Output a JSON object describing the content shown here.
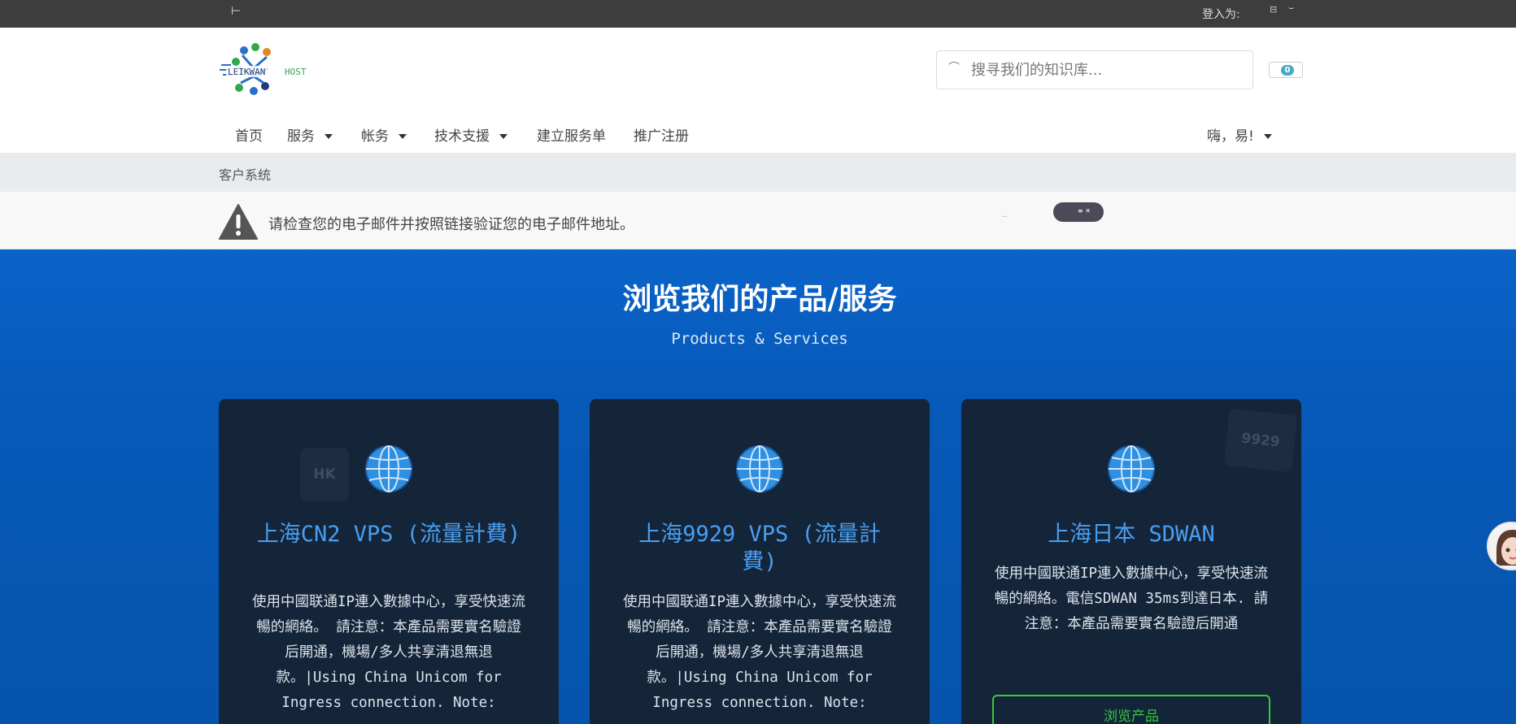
{
  "topbar": {
    "back_glyph": "⊢",
    "login_label": "登入为:",
    "icon1_glyph": "⊟",
    "icon2_glyph": "⌣"
  },
  "header": {
    "logo_text_left": "LEIKWAN",
    "logo_text_right": "HOST",
    "search_placeholder": "搜寻我们的知识库...",
    "cart_count": "0"
  },
  "nav": {
    "items": [
      {
        "label": "首页"
      },
      {
        "label": "服务"
      },
      {
        "label": "帐务"
      },
      {
        "label": "技术支援"
      },
      {
        "label": "建立服务单"
      },
      {
        "label": "推广注册"
      }
    ],
    "user_label": "嗨，易!"
  },
  "breadcrumb": {
    "label": "客户系统"
  },
  "alert": {
    "message": "请检查您的电子邮件并按照链接验证您的电子邮件地址。",
    "dots": "..",
    "pill_text": "≡ ✕"
  },
  "hero": {
    "title": "浏览我们的产品/服务",
    "subtitle": "Products & Services"
  },
  "cards": [
    {
      "title": "上海CN2 VPS (流量計費)",
      "description": "使用中國联通IP連入數據中心，享受快速流暢的網絡。 請注意：本產品需要實名驗證后開通，機場/多人共享清退無退款。|Using China Unicom for Ingress connection. Note:",
      "tag": "HK",
      "icon": "globe-icon"
    },
    {
      "title": "上海9929 VPS (流量計費)",
      "description": "使用中國联通IP連入數據中心，享受快速流暢的網絡。 請注意：本產品需要實名驗證后開通，機場/多人共享清退無退款。|Using China Unicom for Ingress connection. Note:",
      "icon": "globe-icon"
    },
    {
      "title": "上海日本 SDWAN",
      "description": "使用中國联通IP連入數據中心，享受快速流暢的網絡。電信SDWAN 35ms到達日本. 請注意：本產品需要實名驗證后開通",
      "tag": "9929",
      "button_label": "浏览产品",
      "icon": "globe-icon"
    }
  ],
  "colors": {
    "topbar": "#3d3d3d",
    "hero": "#0a63c9",
    "card": "#14253a",
    "card_title": "#4a9ef0",
    "button_green": "#38c838",
    "badge": "#4aa8c8"
  }
}
